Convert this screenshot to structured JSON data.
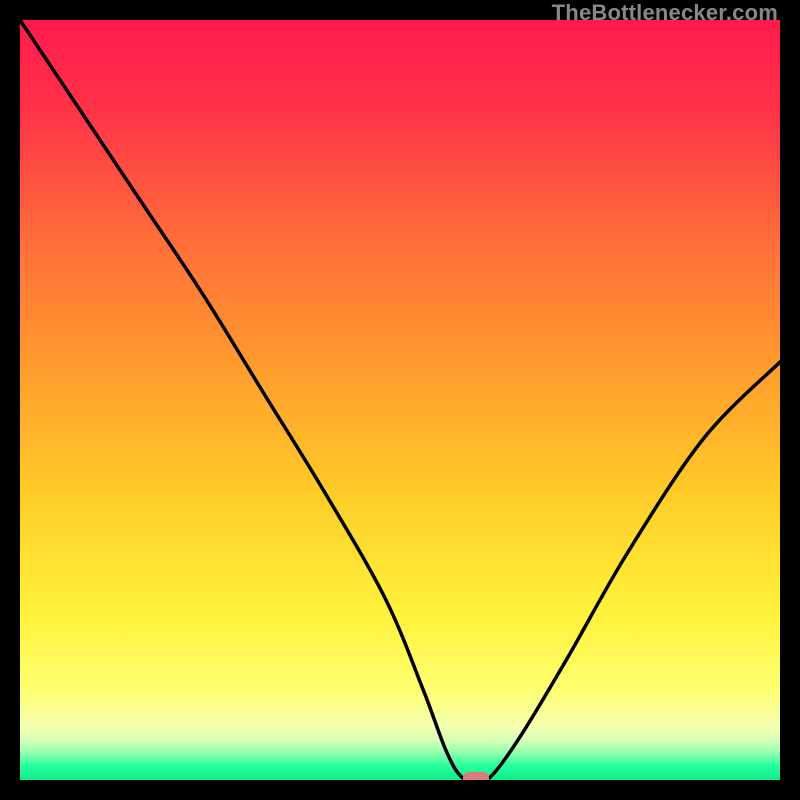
{
  "watermark": "TheBottlenecker.com",
  "chart_data": {
    "type": "line",
    "title": "",
    "xlabel": "",
    "ylabel": "",
    "xlim": [
      0,
      100
    ],
    "ylim": [
      0,
      100
    ],
    "background_gradient_note": "Vertical gradient from red (top) through orange/yellow to pale-yellow then a thin bright-green band at the very bottom",
    "series": [
      {
        "name": "bottleneck-curve",
        "x": [
          0,
          8,
          16,
          24,
          32,
          40,
          48,
          53,
          56,
          58,
          60,
          62,
          66,
          72,
          80,
          90,
          100
        ],
        "y": [
          100,
          88,
          76,
          64,
          51,
          38,
          24,
          12,
          4,
          0.5,
          0,
          0.5,
          6,
          16,
          30,
          45,
          55
        ]
      }
    ],
    "marker": {
      "name": "optimal-point",
      "x": 60,
      "y": 0,
      "color": "#d97b7b"
    }
  }
}
